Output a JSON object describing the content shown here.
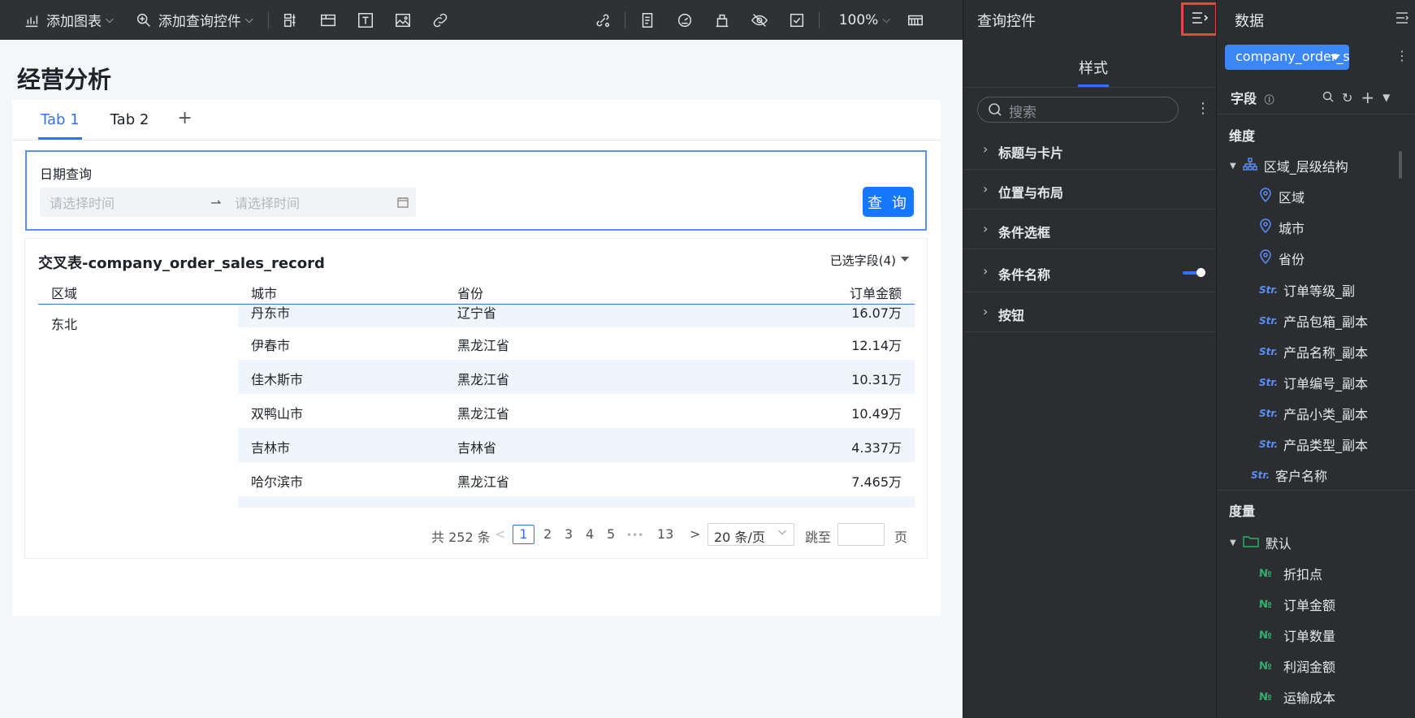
{
  "toolbar": {
    "add_chart": "添加图表",
    "add_query": "添加查询控件",
    "zoom": "100%"
  },
  "page": {
    "title": "经营分析",
    "tabs": [
      "Tab 1",
      "Tab 2"
    ],
    "tab_add": "+"
  },
  "query": {
    "label": "日期查询",
    "start_placeholder": "请选择时间",
    "end_placeholder": "请选择时间",
    "button": "查 询"
  },
  "table": {
    "title": "交叉表-company_order_sales_record",
    "selected_fields": "已选字段(4)",
    "columns": [
      "区域",
      "城市",
      "省份",
      "订单金额"
    ],
    "region": "东北",
    "rows": [
      {
        "city": "丹东市",
        "province": "辽宁省",
        "amount": "16.07万"
      },
      {
        "city": "伊春市",
        "province": "黑龙江省",
        "amount": "12.14万"
      },
      {
        "city": "佳木斯市",
        "province": "黑龙江省",
        "amount": "10.31万"
      },
      {
        "city": "双鸭山市",
        "province": "黑龙江省",
        "amount": "10.49万"
      },
      {
        "city": "吉林市",
        "province": "吉林省",
        "amount": "4.337万"
      },
      {
        "city": "哈尔滨市",
        "province": "黑龙江省",
        "amount": "7.465万"
      }
    ],
    "pager": {
      "total": "共 252 条",
      "prev": "<",
      "current": "1",
      "pages": [
        "2",
        "3",
        "4",
        "5"
      ],
      "ellipsis": "•••",
      "last": "13",
      "next": ">",
      "page_size": "20 条/页",
      "jump_label": "跳至",
      "page_unit": "页"
    }
  },
  "query_panel": {
    "title": "查询控件",
    "tab": "样式",
    "search_placeholder": "搜索",
    "sections": [
      "标题与卡片",
      "位置与布局",
      "条件选框",
      "条件名称",
      "按钮"
    ],
    "condition_name_toggle": true
  },
  "data_panel": {
    "title": "数据",
    "dataset": "company_order_s...",
    "fields_label": "字段",
    "dimension_header": "维度",
    "hierarchy": "区域_层级结构",
    "geo_fields": [
      "区域",
      "城市",
      "省份"
    ],
    "str_fields": [
      "订单等级_副",
      "产品包箱_副本",
      "产品名称_副本",
      "订单编号_副本",
      "产品小类_副本",
      "产品类型_副本"
    ],
    "customer": "客户名称",
    "measure_header": "度量",
    "measure_group": "默认",
    "measures": [
      "折扣点",
      "订单金额",
      "订单数量",
      "利润金额",
      "运输成本"
    ],
    "str_tag": "Str.",
    "num_tag": "№"
  },
  "colors": {
    "accent": "#3370ff",
    "dark_bg": "#2b2d30",
    "highlight_box": "#e5483f"
  }
}
